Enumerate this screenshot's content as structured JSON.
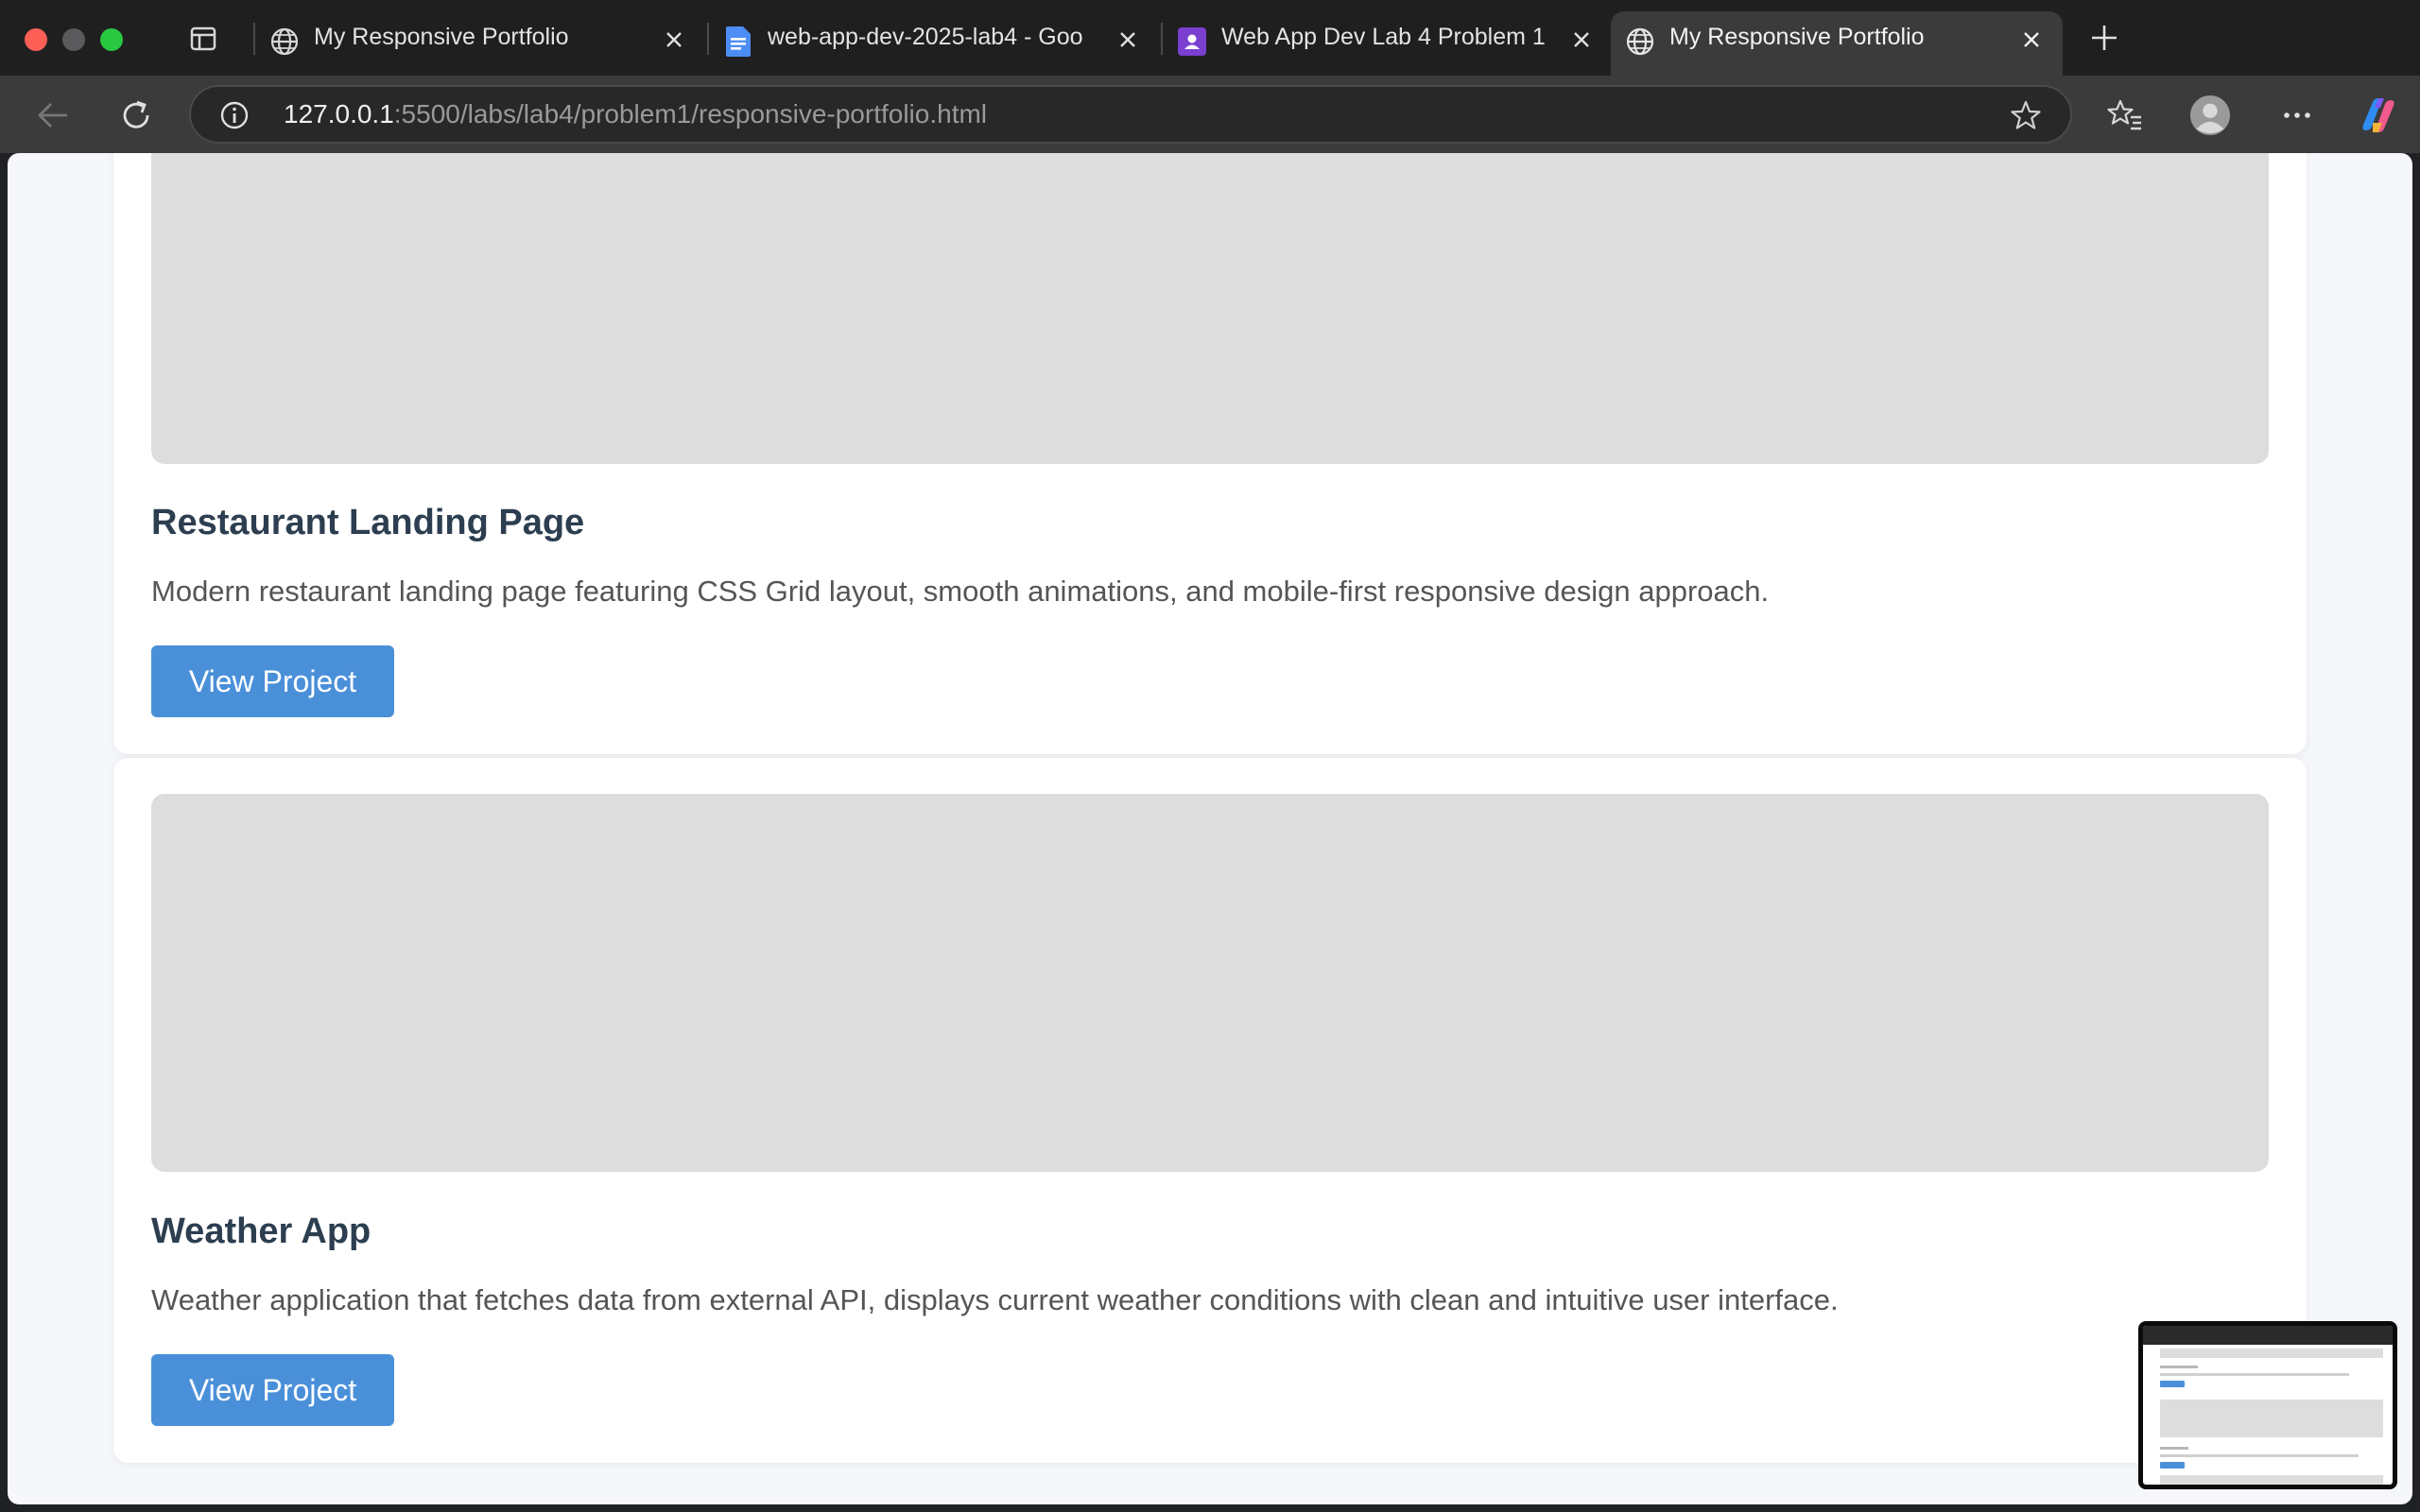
{
  "browser": {
    "tabs": [
      {
        "title": "My Responsive Portfolio",
        "icon": "globe-icon",
        "active": false
      },
      {
        "title": "web-app-dev-2025-lab4 - Goo",
        "icon": "google-docs-icon",
        "active": false
      },
      {
        "title": "Web App Dev Lab 4 Problem 1",
        "icon": "classroom-icon",
        "active": false
      },
      {
        "title": "My Responsive Portfolio",
        "icon": "globe-icon",
        "active": true
      }
    ],
    "url_host": "127.0.0.1",
    "url_rest": ":5500/labs/lab4/problem1/responsive-portfolio.html",
    "colors": {
      "tabstrip": "#1f1f1f",
      "toolbar": "#3b3b3b",
      "docs_blue": "#4d8df6",
      "classroom_purple": "#7b3fd0"
    }
  },
  "projects": [
    {
      "title": "Restaurant Landing Page",
      "description": "Modern restaurant landing page featuring CSS Grid layout, smooth animations, and mobile-first responsive design approach.",
      "button_label": "View Project"
    },
    {
      "title": "Weather App",
      "description": "Weather application that fetches data from external API, displays current weather conditions with clean and intuitive user interface.",
      "button_label": "View Project"
    }
  ],
  "theme": {
    "accent": "#4a90d9",
    "heading": "#2c3e50",
    "body_text": "#555555",
    "placeholder": "#dddddd",
    "page_bg": "#f5f7fa"
  }
}
